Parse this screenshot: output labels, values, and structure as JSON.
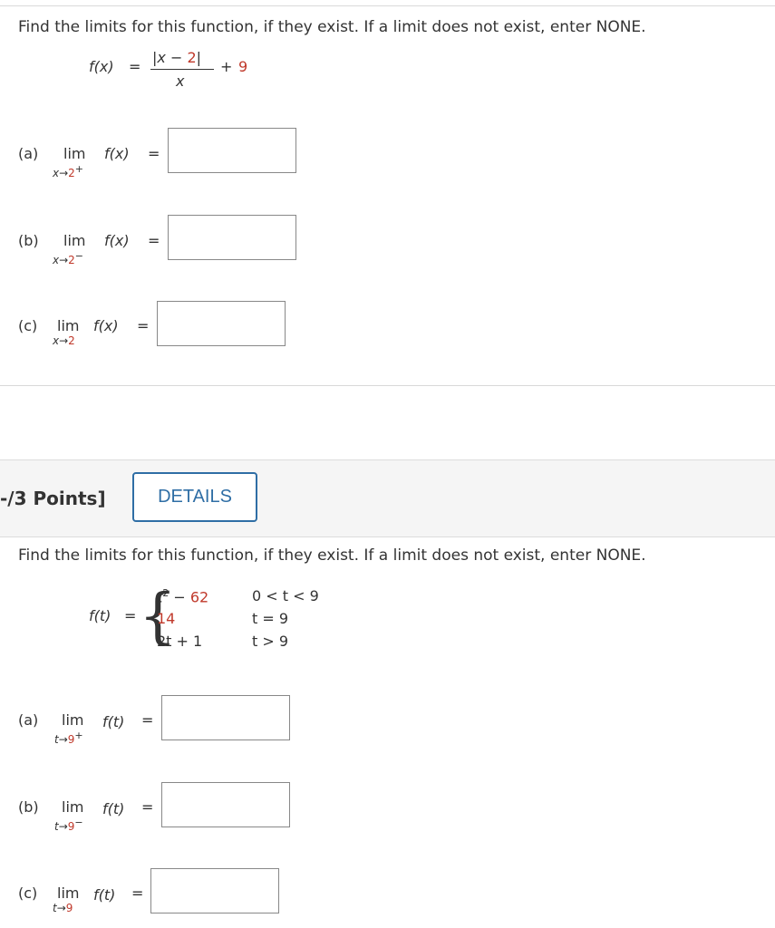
{
  "q1": {
    "prompt": "Find the limits for this function, if they exist. If a limit does not exist, enter NONE.",
    "fx": "f(x)",
    "eq": "=",
    "num_open": "|x −",
    "num_val": "2",
    "num_close": "|",
    "den": "x",
    "plus": "+",
    "const": "9",
    "parts": [
      {
        "label": "(a)",
        "lim": "lim",
        "var": "x→",
        "val": "2",
        "dir": "+",
        "func": "f(x)",
        "eq": "="
      },
      {
        "label": "(b)",
        "lim": "lim",
        "var": "x→",
        "val": "2",
        "dir": "−",
        "func": "f(x)",
        "eq": "="
      },
      {
        "label": "(c)",
        "lim": "lim",
        "var": "x→",
        "val": "2",
        "dir": "",
        "func": "f(x)",
        "eq": "="
      }
    ]
  },
  "q2": {
    "points": "-/3 Points]",
    "details": "DETAILS",
    "prompt": "Find the limits for this function, if they exist. If a limit does not exist, enter NONE.",
    "ft": "f(t)",
    "eq": "=",
    "cases": [
      {
        "expr_a": "t",
        "expr_sup": "2",
        "expr_b": " − ",
        "expr_c": "62",
        "cond": "0 < t < 9"
      },
      {
        "expr_a": "",
        "expr_sup": "",
        "expr_b": "",
        "expr_c": "14",
        "cond": "t = 9"
      },
      {
        "expr_a": "2t + 1",
        "expr_sup": "",
        "expr_b": "",
        "expr_c": "",
        "cond": "t > 9"
      }
    ],
    "parts": [
      {
        "label": "(a)",
        "lim": "lim",
        "var": "t→",
        "val": "9",
        "dir": "+",
        "func": "f(t)",
        "eq": "="
      },
      {
        "label": "(b)",
        "lim": "lim",
        "var": "t→",
        "val": "9",
        "dir": "−",
        "func": "f(t)",
        "eq": "="
      },
      {
        "label": "(c)",
        "lim": "lim",
        "var": "t→",
        "val": "9",
        "dir": "",
        "func": "f(t)",
        "eq": "="
      }
    ]
  },
  "colors": {
    "accent": "#2f6ea5",
    "value_red": "#c0392b",
    "header_bg": "#f5f5f5"
  }
}
